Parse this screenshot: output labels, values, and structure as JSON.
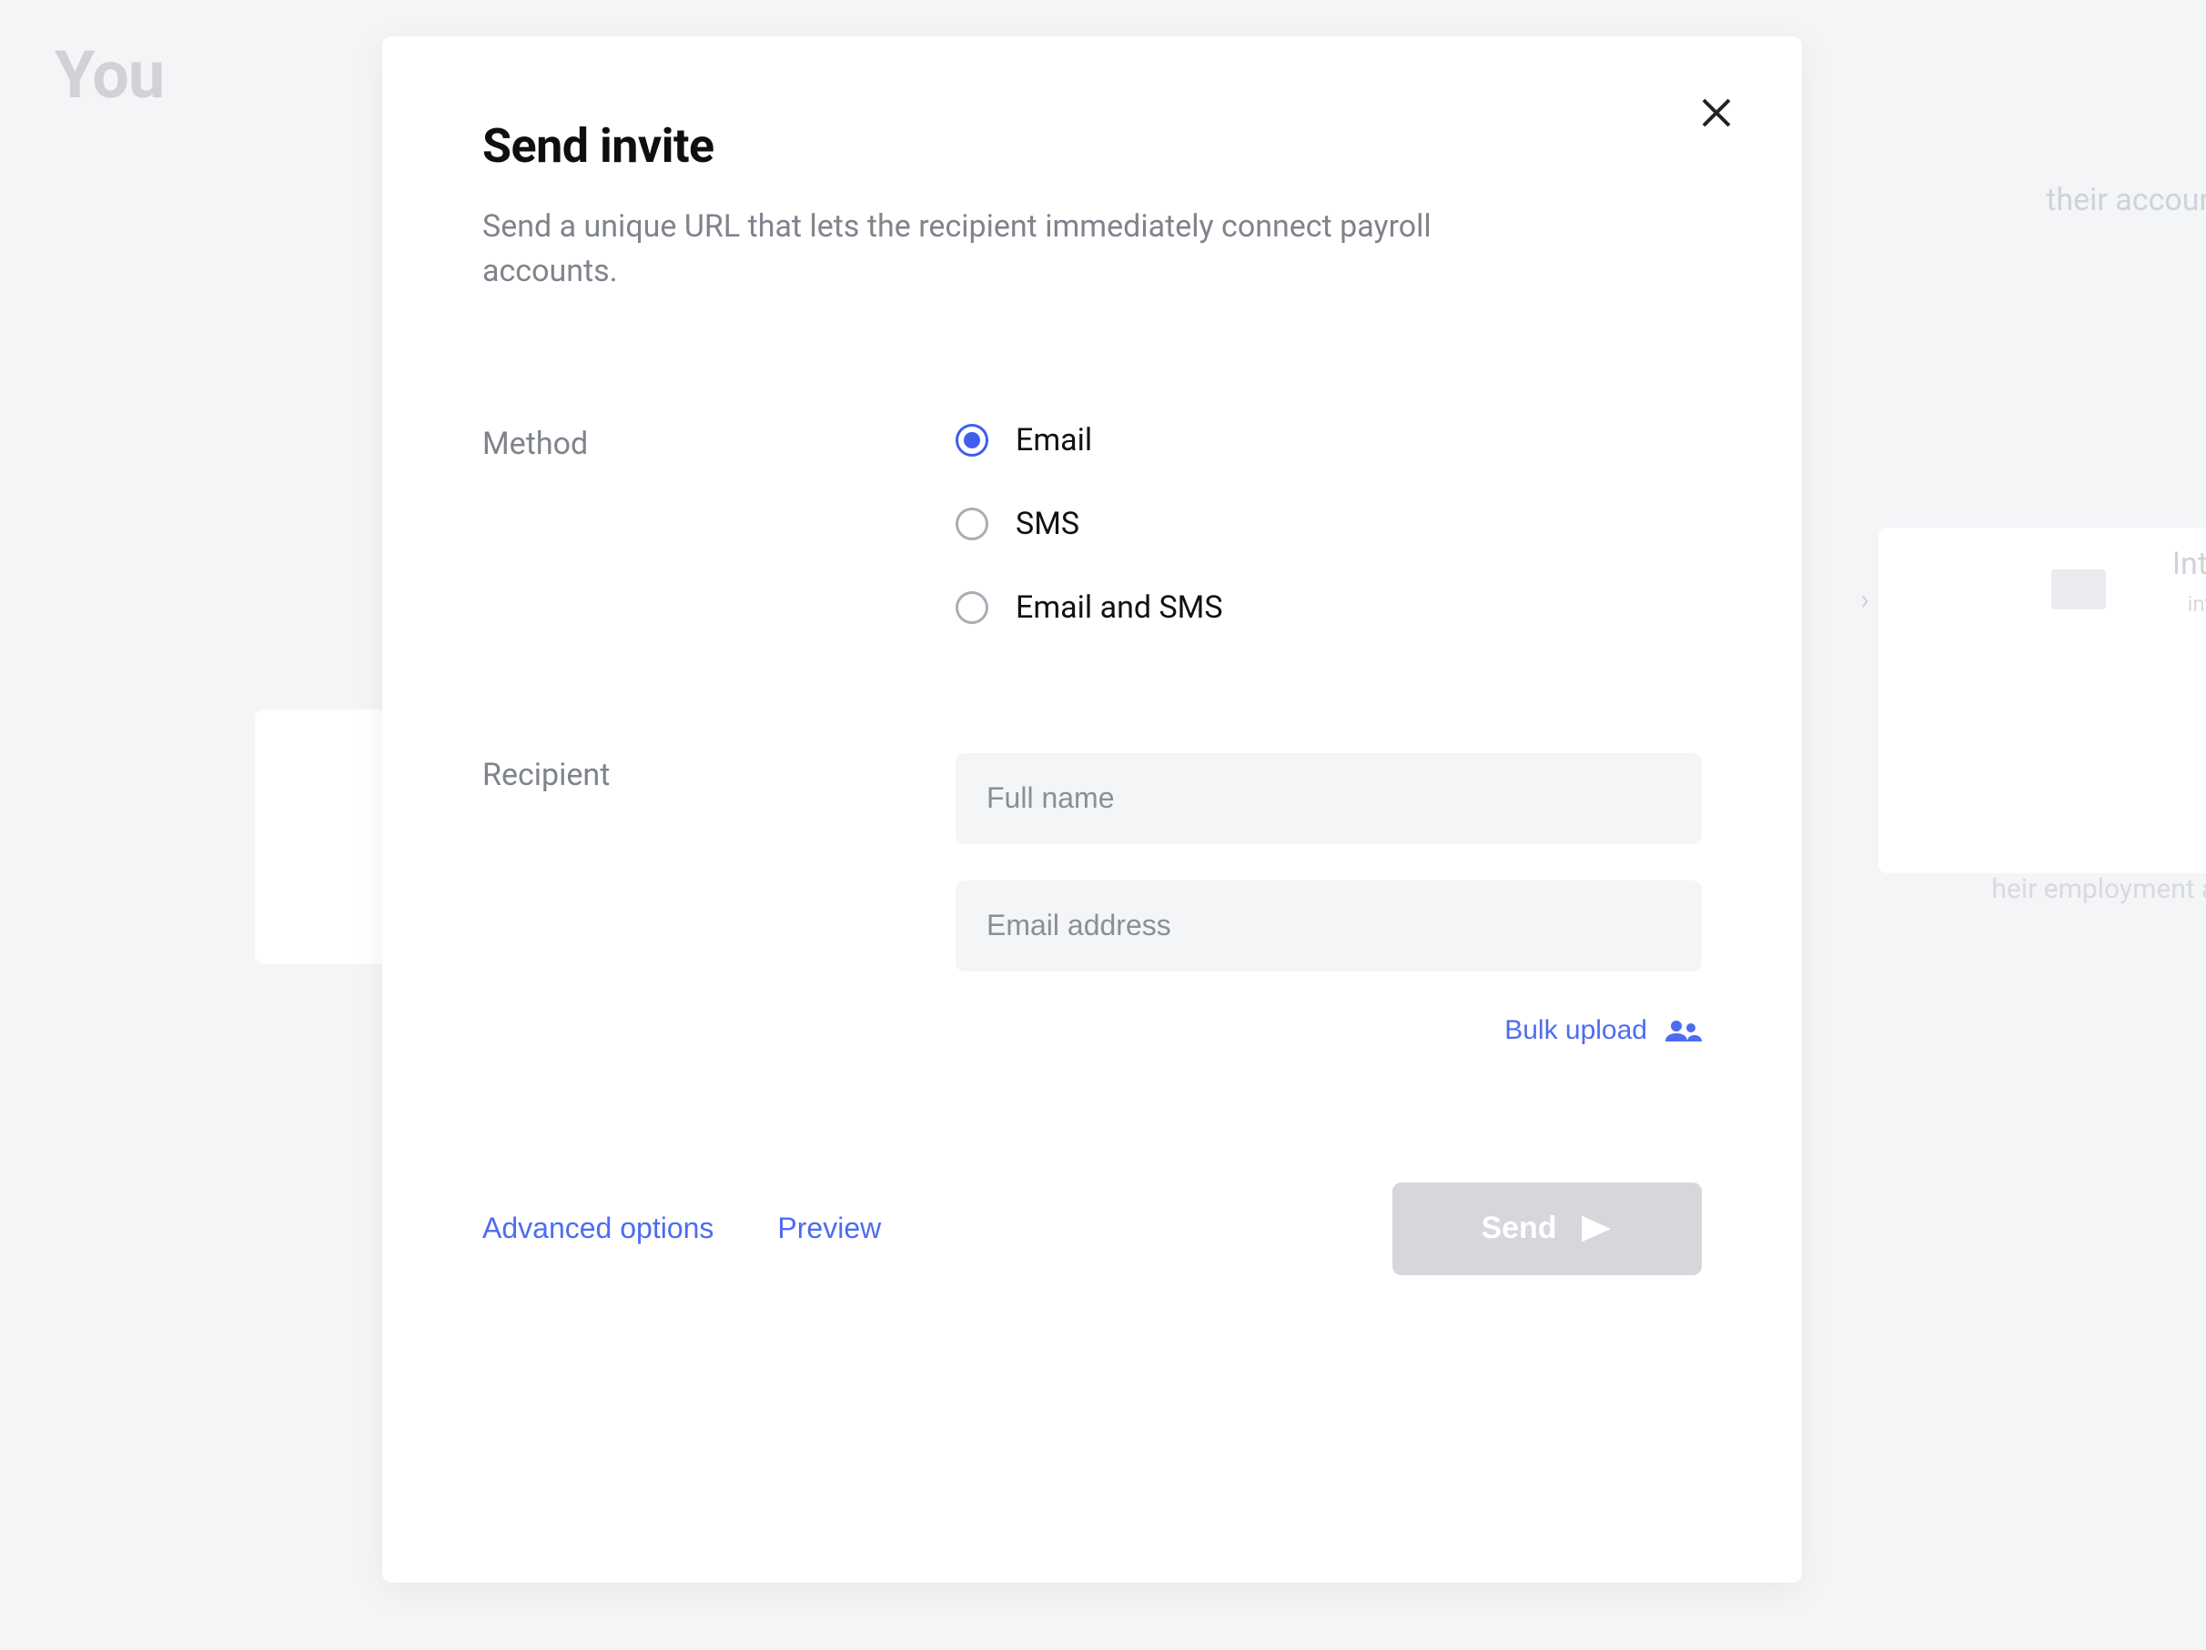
{
  "backdrop": {
    "title_fragment": "You",
    "tagline_fragment": "their accounts",
    "inte": "Inte",
    "into": "into",
    "emp": "heir employment acco"
  },
  "modal": {
    "title": "Send invite",
    "description": "Send a unique URL that lets the recipient immediately connect payroll accounts.",
    "method_label": "Method",
    "methods": {
      "email": "Email",
      "sms": "SMS",
      "both": "Email and SMS"
    },
    "selected_method": "email",
    "recipient_label": "Recipient",
    "full_name_placeholder": "Full name",
    "full_name_value": "",
    "email_placeholder": "Email address",
    "email_value": "",
    "bulk_upload_label": "Bulk upload",
    "advanced_label": "Advanced options",
    "preview_label": "Preview",
    "send_label": "Send"
  }
}
